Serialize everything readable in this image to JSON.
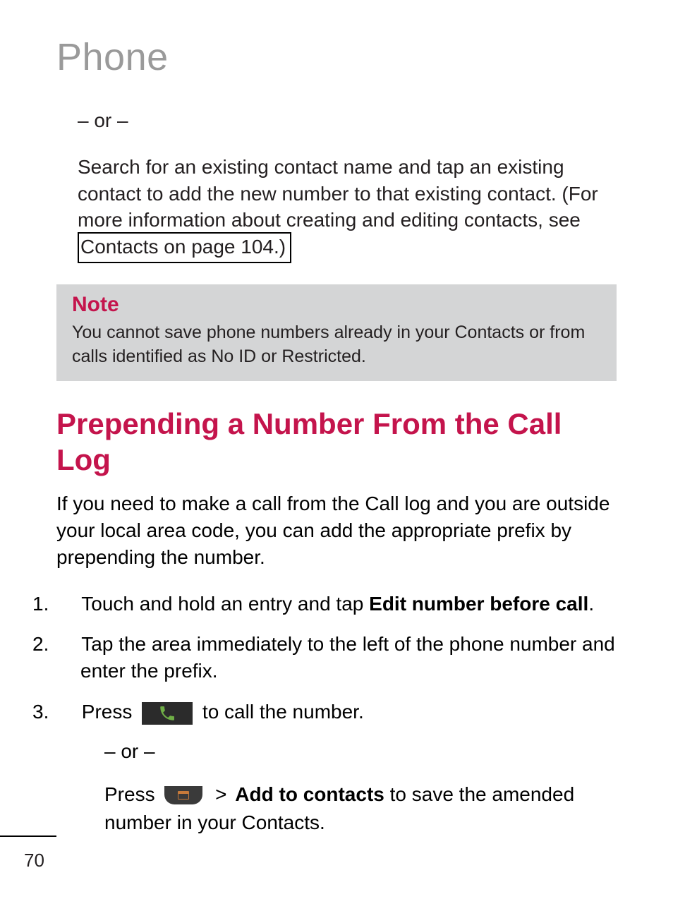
{
  "chapter": {
    "title": "Phone"
  },
  "continuation": {
    "or": "– or –",
    "search_text_a": "Search for an existing contact name and tap an existing contact to add the new number to that existing contact. (For more information about creating and editing contacts, see ",
    "boxed_link": "Contacts on page 104.)"
  },
  "note": {
    "label": "Note",
    "text": "You cannot save phone numbers already in your Contacts or from calls identified as No ID or Restricted."
  },
  "section": {
    "heading": "Prepending a Number From the Call Log",
    "intro": "If you need to make a call from the Call log and you are outside your local area code, you can add the appropriate prefix by prepending the number."
  },
  "steps": {
    "s1_num": "1.",
    "s1_a": " Touch and hold an entry and tap ",
    "s1_bold": "Edit number before call",
    "s1_b": ".",
    "s2_num": "2.",
    "s2": " Tap the area immediately to the left of the phone number and enter the prefix.",
    "s3_num": "3.",
    "s3_a": " Press ",
    "s3_b": " to call the number.",
    "s3_or": "– or –",
    "s3_press_a": "Press ",
    "s3_gt": ">",
    "s3_bold": "Add to contacts",
    "s3_press_b": " to save the amended number in your Contacts."
  },
  "icons": {
    "call": "call-icon",
    "menu": "menu-icon"
  },
  "page_number": "70"
}
